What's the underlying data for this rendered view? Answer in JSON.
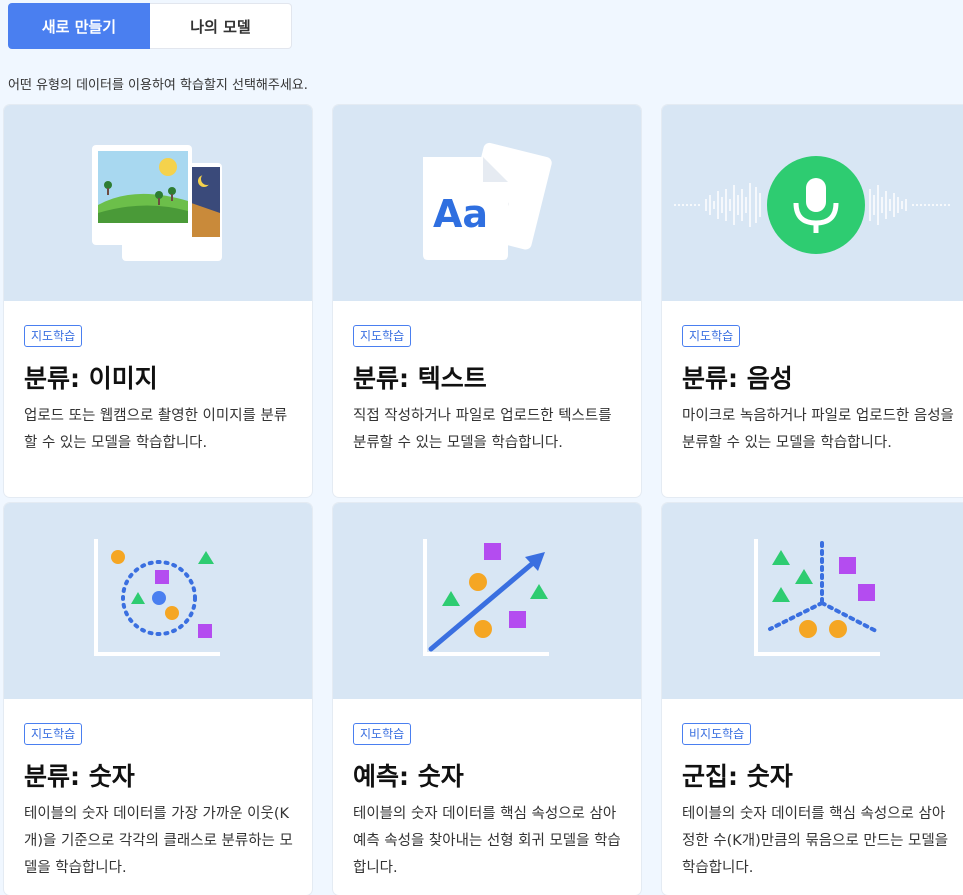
{
  "tabs": {
    "new_label": "새로 만들기",
    "my_models_label": "나의 모델"
  },
  "instruction": "어떤 유형의 데이터를 이용하여 학습할지 선택해주세요.",
  "colors": {
    "accent": "#4a7ff0",
    "thumb_bg": "#d8e6f4",
    "green": "#2ecc71",
    "orange": "#f5a623",
    "purple": "#b44cf0"
  },
  "cards": [
    {
      "badge": "지도학습",
      "title": "분류: 이미지",
      "desc": "업로드 또는 웹캠으로 촬영한 이미지를 분류할 수 있는 모델을 학습합니다.",
      "icon": "image-icon"
    },
    {
      "badge": "지도학습",
      "title": "분류: 텍스트",
      "desc": "직접 작성하거나 파일로 업로드한 텍스트를 분류할 수 있는 모델을 학습합니다.",
      "icon": "text-icon"
    },
    {
      "badge": "지도학습",
      "title": "분류: 음성",
      "desc": "마이크로 녹음하거나 파일로 업로드한 음성을 분류할 수 있는 모델을 학습합니다.",
      "icon": "microphone-icon"
    },
    {
      "badge": "지도학습",
      "title": "분류: 숫자",
      "desc": "테이블의 숫자 데이터를 가장 가까운 이웃(K개)을 기준으로 각각의 클래스로 분류하는 모델을 학습합니다.",
      "icon": "knn-chart-icon"
    },
    {
      "badge": "지도학습",
      "title": "예측: 숫자",
      "desc": "테이블의 숫자 데이터를 핵심 속성으로 삼아 예측 속성을 찾아내는 선형 회귀 모델을 학습합니다.",
      "icon": "regression-chart-icon"
    },
    {
      "badge": "비지도학습",
      "title": "군집: 숫자",
      "desc": "테이블의 숫자 데이터를 핵심 속성으로 삼아 정한 수(K개)만큼의 묶음으로 만드는 모델을 학습합니다.",
      "icon": "cluster-chart-icon"
    }
  ]
}
